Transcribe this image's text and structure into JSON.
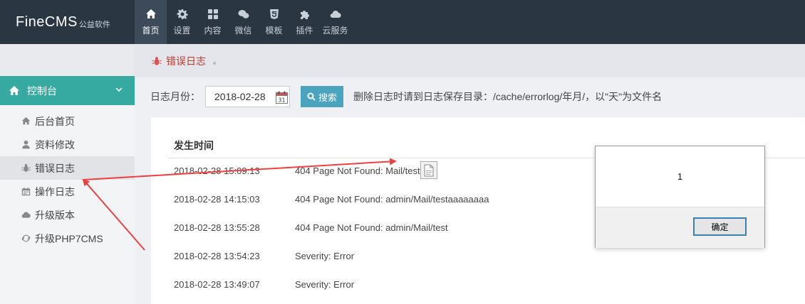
{
  "brand": {
    "name": "FineCMS",
    "sub": "公益软件"
  },
  "topnav": [
    {
      "label": "首页",
      "icon": "home-icon"
    },
    {
      "label": "设置",
      "icon": "gear-icon"
    },
    {
      "label": "内容",
      "icon": "grid-icon"
    },
    {
      "label": "微信",
      "icon": "wechat-icon"
    },
    {
      "label": "模板",
      "icon": "html5-icon"
    },
    {
      "label": "插件",
      "icon": "puzzle-icon"
    },
    {
      "label": "云服务",
      "icon": "cloud-icon"
    }
  ],
  "sidebar": {
    "section": "控制台",
    "items": [
      {
        "label": "后台首页",
        "icon": "home-icon"
      },
      {
        "label": "资料修改",
        "icon": "user-icon"
      },
      {
        "label": "错误日志",
        "icon": "bug-icon"
      },
      {
        "label": "操作日志",
        "icon": "calendar-icon"
      },
      {
        "label": "升级版本",
        "icon": "cloud-icon"
      },
      {
        "label": "升级PHP7CMS",
        "icon": "refresh-icon"
      }
    ]
  },
  "breadcrumb": {
    "label": "错误日志"
  },
  "filter": {
    "label": "日志月份：",
    "date_value": "2018-02-28",
    "search_label": "搜索",
    "note": "删除日志时请到日志保存目录：/cache/errorlog/年月/，以\"天\"为文件名"
  },
  "log_table": {
    "header": "发生时间",
    "rows": [
      {
        "time": "2018-02-28 15:09:13",
        "message": "404 Page Not Found: Mail/test"
      },
      {
        "time": "2018-02-28 14:15:03",
        "message": "404 Page Not Found: admin/Mail/testaaaaaaaa"
      },
      {
        "time": "2018-02-28 13:55:28",
        "message": "404 Page Not Found: admin/Mail/test"
      },
      {
        "time": "2018-02-28 13:54:23",
        "message": "Severity: Error"
      },
      {
        "time": "2018-02-28 13:49:07",
        "message": "Severity: Error"
      }
    ]
  },
  "dialog": {
    "message": "1",
    "ok_label": "确定"
  },
  "colors": {
    "topbar": "#2b3643",
    "accent": "#36a9a0",
    "breadcrumb": "#c0392b",
    "search_button": "#4aa3bf",
    "arrow": "#ee4040"
  }
}
